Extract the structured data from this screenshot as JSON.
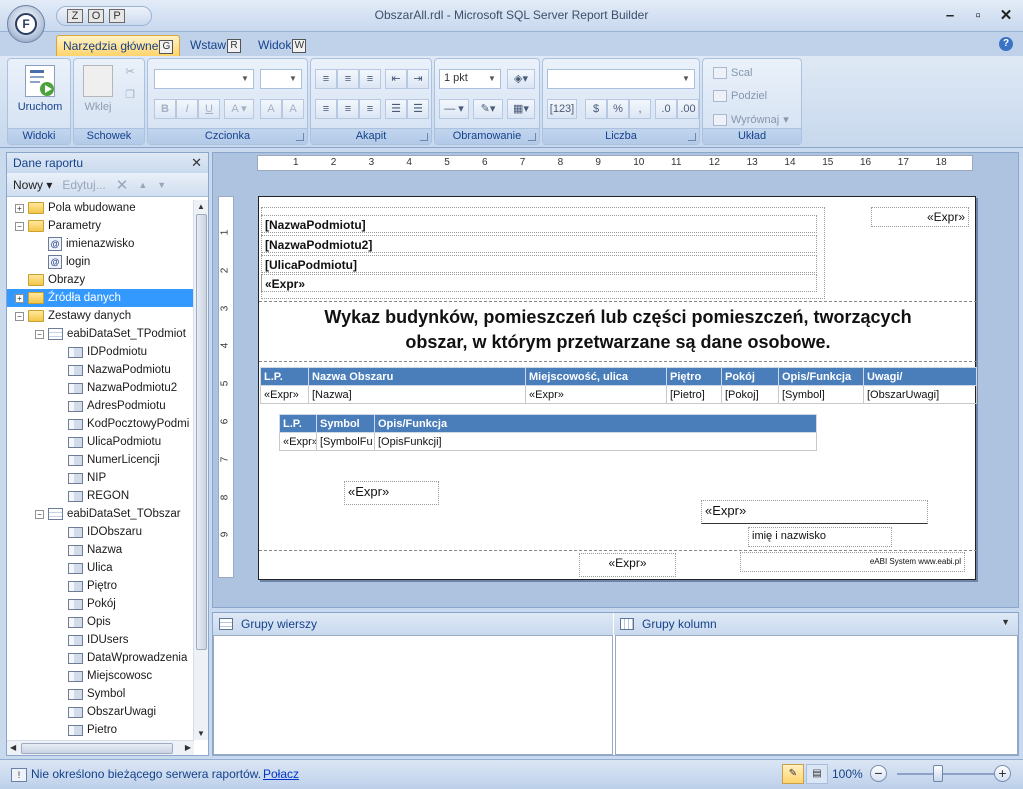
{
  "app": {
    "title": "ObszarAll.rdl - Microsoft SQL Server Report Builder",
    "orb_key": "F",
    "qat_keys": [
      "Z",
      "O",
      "P"
    ],
    "window_buttons": [
      "–",
      "▫",
      "✕"
    ]
  },
  "tabs": [
    {
      "label": "Narzędzia główne",
      "key": "G"
    },
    {
      "label": "Wstaw",
      "key": "R"
    },
    {
      "label": "Widok",
      "key": "W"
    }
  ],
  "ribbon": {
    "groups": {
      "widoki": "Widoki",
      "schowek": "Schowek",
      "czcionka": "Czcionka",
      "akapit": "Akapit",
      "obramowanie": "Obramowanie",
      "liczba": "Liczba",
      "uklad": "Układ"
    },
    "run_label": "Uruchom",
    "paste_label": "Wklej",
    "border_width": "1 pkt",
    "merge_label": "Scal",
    "split_label": "Podziel",
    "align_label": "Wyrównaj"
  },
  "left_pane": {
    "title": "Dane raportu",
    "new_label": "Nowy",
    "edit_label": "Edytuj...",
    "tree": [
      {
        "label": "Pola wbudowane",
        "indent": 0,
        "exp": "+",
        "icon": "folder"
      },
      {
        "label": "Parametry",
        "indent": 0,
        "exp": "−",
        "icon": "folder"
      },
      {
        "label": "imienazwisko",
        "indent": 1,
        "exp": "",
        "icon": "param"
      },
      {
        "label": "login",
        "indent": 1,
        "exp": "",
        "icon": "param"
      },
      {
        "label": "Obrazy",
        "indent": 0,
        "exp": "",
        "icon": "folder"
      },
      {
        "label": "Źródła danych",
        "indent": 0,
        "exp": "+",
        "icon": "folder",
        "selected": true
      },
      {
        "label": "Zestawy danych",
        "indent": 0,
        "exp": "−",
        "icon": "folder"
      },
      {
        "label": "eabiDataSet_TPodmiot",
        "indent": 1,
        "exp": "−",
        "icon": "dataset"
      },
      {
        "label": "IDPodmiotu",
        "indent": 2,
        "exp": "",
        "icon": "field"
      },
      {
        "label": "NazwaPodmiotu",
        "indent": 2,
        "exp": "",
        "icon": "field"
      },
      {
        "label": "NazwaPodmiotu2",
        "indent": 2,
        "exp": "",
        "icon": "field"
      },
      {
        "label": "AdresPodmiotu",
        "indent": 2,
        "exp": "",
        "icon": "field"
      },
      {
        "label": "KodPocztowyPodmi",
        "indent": 2,
        "exp": "",
        "icon": "field"
      },
      {
        "label": "UlicaPodmiotu",
        "indent": 2,
        "exp": "",
        "icon": "field"
      },
      {
        "label": "NumerLicencji",
        "indent": 2,
        "exp": "",
        "icon": "field"
      },
      {
        "label": "NIP",
        "indent": 2,
        "exp": "",
        "icon": "field"
      },
      {
        "label": "REGON",
        "indent": 2,
        "exp": "",
        "icon": "field"
      },
      {
        "label": "eabiDataSet_TObszar",
        "indent": 1,
        "exp": "−",
        "icon": "dataset"
      },
      {
        "label": "IDObszaru",
        "indent": 2,
        "exp": "",
        "icon": "field"
      },
      {
        "label": "Nazwa",
        "indent": 2,
        "exp": "",
        "icon": "field"
      },
      {
        "label": "Ulica",
        "indent": 2,
        "exp": "",
        "icon": "field"
      },
      {
        "label": "Piętro",
        "indent": 2,
        "exp": "",
        "icon": "field"
      },
      {
        "label": "Pokój",
        "indent": 2,
        "exp": "",
        "icon": "field"
      },
      {
        "label": "Opis",
        "indent": 2,
        "exp": "",
        "icon": "field"
      },
      {
        "label": "IDUsers",
        "indent": 2,
        "exp": "",
        "icon": "field"
      },
      {
        "label": "DataWprowadzenia",
        "indent": 2,
        "exp": "",
        "icon": "field"
      },
      {
        "label": "Miejscowosc",
        "indent": 2,
        "exp": "",
        "icon": "field"
      },
      {
        "label": "Symbol",
        "indent": 2,
        "exp": "",
        "icon": "field"
      },
      {
        "label": "ObszarUwagi",
        "indent": 2,
        "exp": "",
        "icon": "field"
      },
      {
        "label": "Pietro",
        "indent": 2,
        "exp": "",
        "icon": "field"
      }
    ]
  },
  "ruler": {
    "h_numbers": [
      "1",
      "2",
      "3",
      "4",
      "5",
      "6",
      "7",
      "8",
      "9",
      "10",
      "11",
      "12",
      "13",
      "14",
      "15",
      "16",
      "17",
      "18"
    ],
    "v_numbers": [
      "1",
      "2",
      "3",
      "4",
      "5",
      "6",
      "7",
      "8",
      "9"
    ]
  },
  "report": {
    "header_fields": [
      "[NazwaPodmiotu]",
      "[NazwaPodmiotu2]",
      "[UlicaPodmiotu]",
      "«Expr»"
    ],
    "top_right_expr": "«Expr»",
    "title_line1": "Wykaz budynków, pomieszczeń lub części pomieszczeń, tworzących",
    "title_line2": "obszar, w którym przetwarzane są dane osobowe.",
    "main_table": {
      "headers": [
        "L.P.",
        "Nazwa Obszaru",
        "Miejscowość, ulica",
        "Piętro",
        "Pokój",
        "Opis/Funkcja",
        "Uwagi/"
      ],
      "row": [
        "«Expr»",
        "[Nazwa]",
        "«Expr»",
        "[Pietro]",
        "[Pokoj]",
        "[Symbol]",
        "[ObszarUwagi]"
      ]
    },
    "sub_table": {
      "headers": [
        "L.P.",
        "Symbol",
        "Opis/Funkcja"
      ],
      "row": [
        "«Expr»",
        "[SymbolFu",
        "[OpisFunkcji]"
      ]
    },
    "expr_left": "«Expr»",
    "expr_right": "«Expr»",
    "signature_label": "imię i nazwisko",
    "footer_expr": "«Expr»",
    "footer_brand": "eABI System  www.eabi.pl"
  },
  "groups": {
    "rows_label": "Grupy wierszy",
    "cols_label": "Grupy kolumn"
  },
  "status": {
    "message": "Nie określono bieżącego serwera raportów.",
    "connect_link": "Połacz",
    "zoom": "100%"
  }
}
